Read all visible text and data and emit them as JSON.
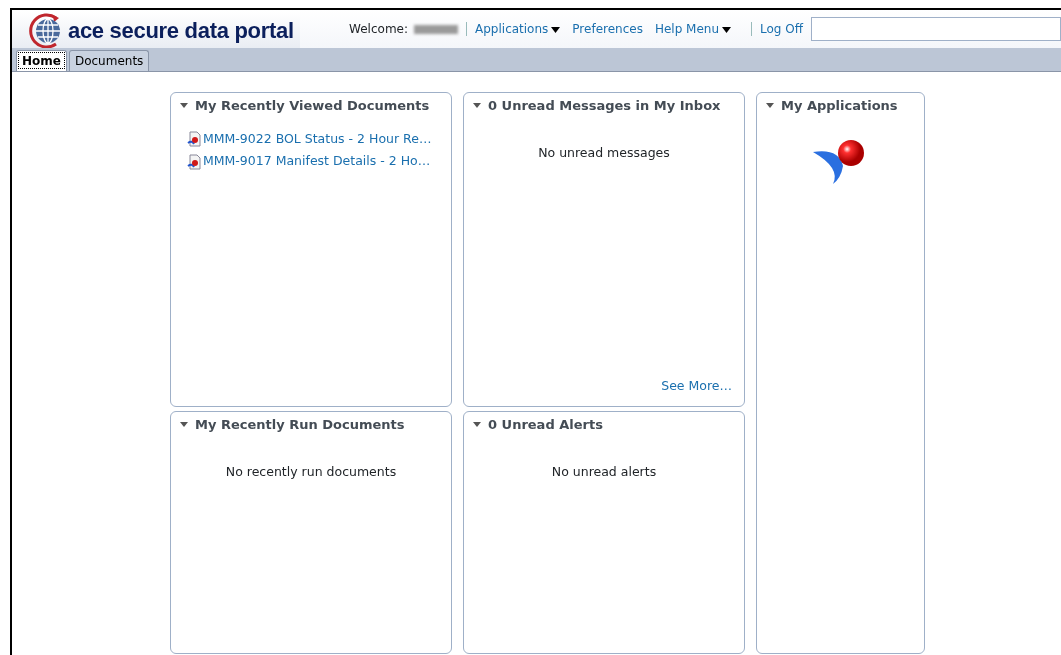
{
  "logo": {
    "text": "ace secure data portal"
  },
  "header": {
    "welcome": "Welcome:",
    "menu": [
      {
        "label": "Applications",
        "dropdown": true
      },
      {
        "label": "Preferences",
        "dropdown": false
      },
      {
        "label": "Help Menu",
        "dropdown": true
      }
    ],
    "logoff": "Log Off"
  },
  "tabs": [
    {
      "label": "Home",
      "selected": true
    },
    {
      "label": "Documents",
      "selected": false
    }
  ],
  "panels": [
    {
      "title": "My Recently Viewed Documents",
      "expanded": true,
      "kind": "documents",
      "items": [
        "MMM-9022 BOL Status - 2 Hour Re…",
        "MMM-9017 Manifest Details - 2 Ho…"
      ]
    },
    {
      "title": "0 Unread Messages in My Inbox",
      "expanded": true,
      "kind": "message",
      "message": "No unread messages",
      "link": "See More…"
    },
    {
      "title": "My Applications",
      "expanded": true,
      "kind": "apps"
    },
    {
      "title": "My Recently Run Documents",
      "expanded": true,
      "kind": "message",
      "message": "No recently run documents"
    },
    {
      "title": "0 Unread Alerts",
      "expanded": true,
      "kind": "message",
      "message": "No unread alerts"
    }
  ]
}
